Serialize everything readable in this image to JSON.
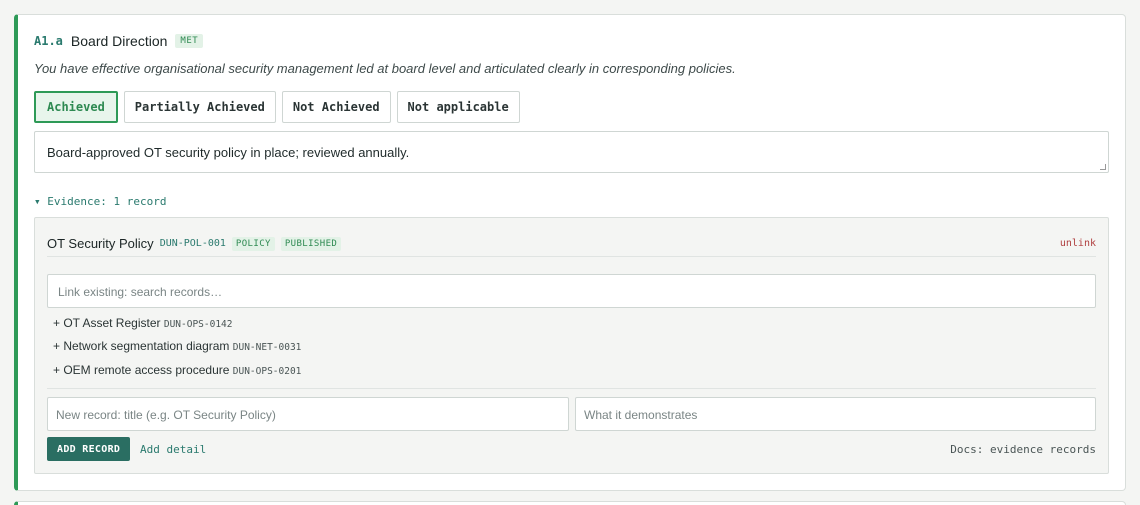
{
  "requirement": {
    "code": "A1.a",
    "title": "Board Direction",
    "status_badge": "MET",
    "description": "You have effective organisational security management led at board level and articulated clearly in corresponding policies."
  },
  "options": {
    "achieved": "Achieved",
    "partial": "Partially Achieved",
    "not_achieved": "Not Achieved",
    "na": "Not applicable",
    "selected": "Achieved"
  },
  "note": {
    "value": "Board-approved OT security policy in place; reviewed annually."
  },
  "evidence": {
    "toggle_label": "▾ Evidence: 1 record",
    "record": {
      "title": "OT Security Policy",
      "id": "DUN-POL-001",
      "type_tag": "POLICY",
      "status_tag": "PUBLISHED",
      "unlink_label": "unlink"
    },
    "search_placeholder": "Link existing: search records…",
    "suggestions": [
      {
        "label": "+ OT Asset Register",
        "id": "DUN-OPS-0142"
      },
      {
        "label": "+ Network segmentation diagram",
        "id": "DUN-NET-0031"
      },
      {
        "label": "+ OEM remote access procedure",
        "id": "DUN-OPS-0201"
      }
    ],
    "new_title_placeholder": "New record: title (e.g. OT Security Policy)",
    "new_demo_placeholder": "What it demonstrates",
    "add_record_label": "ADD RECORD",
    "add_detail_label": "Add detail",
    "docs_label": "Docs: evidence records"
  },
  "colors": {
    "accent": "#2e9a57",
    "teal": "#2a6e62",
    "danger": "#b04040"
  }
}
